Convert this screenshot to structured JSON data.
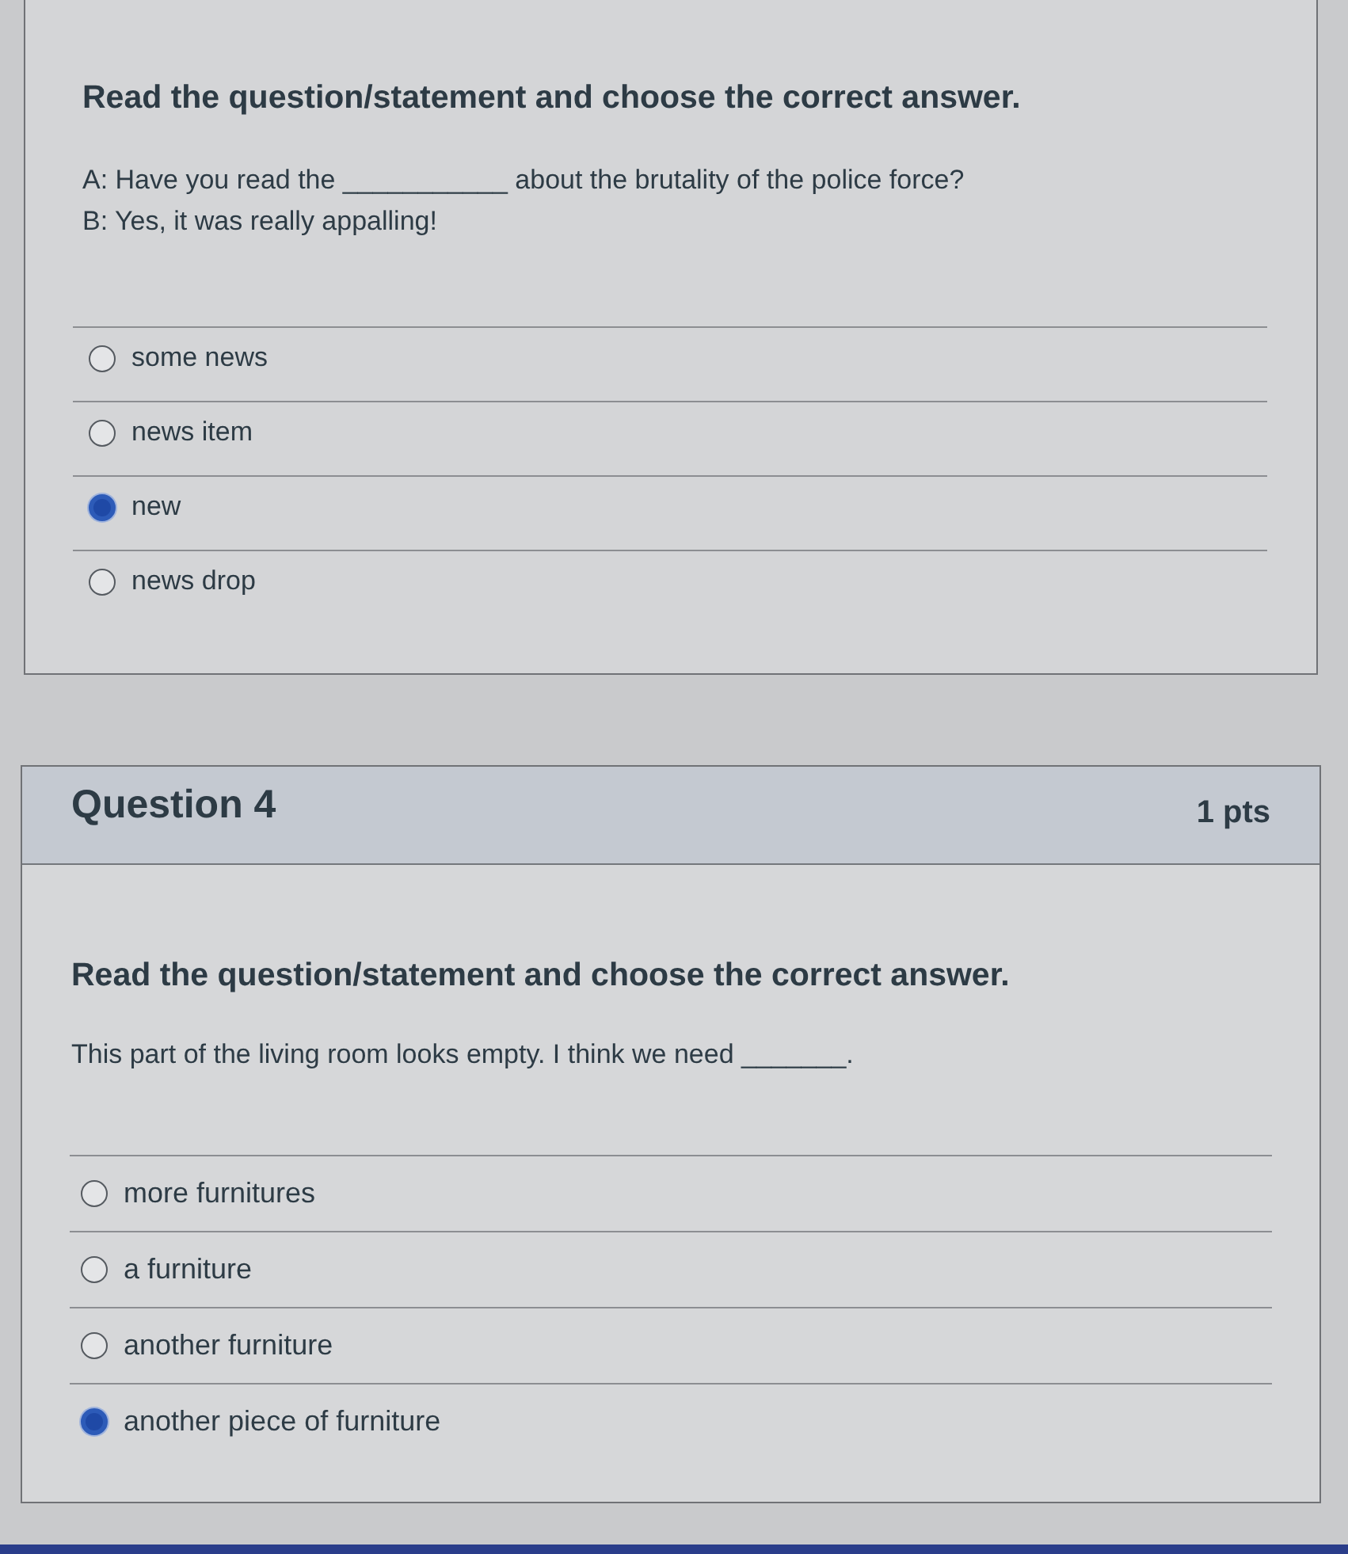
{
  "questions": [
    {
      "title": "Read the question/statement and choose the correct answer.",
      "prompt_lines": [
        "A: Have you read the ___________ about the brutality of the police force?",
        "B: Yes, it was really appalling!"
      ],
      "options": [
        {
          "label": "some news",
          "selected": false
        },
        {
          "label": "news item",
          "selected": false
        },
        {
          "label": "new",
          "selected": true
        },
        {
          "label": "news drop",
          "selected": false
        }
      ]
    },
    {
      "header": {
        "title": "Question 4",
        "points": "1 pts"
      },
      "title": "Read the question/statement and choose the correct answer.",
      "prompt_lines": [
        "This part of the living room looks empty. I think we need _______."
      ],
      "options": [
        {
          "label": "more furnitures",
          "selected": false
        },
        {
          "label": "a furniture",
          "selected": false
        },
        {
          "label": "another furniture",
          "selected": false
        },
        {
          "label": "another piece of furniture",
          "selected": true
        }
      ]
    }
  ]
}
